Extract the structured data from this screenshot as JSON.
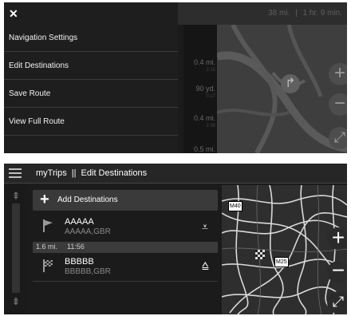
{
  "screen1": {
    "close_icon": "close-icon",
    "eta": {
      "distance": "38 mi.",
      "divider": "|",
      "time": "1 hr. 9 min."
    },
    "menu": [
      {
        "label": "Navigation Settings"
      },
      {
        "label": "Edit Destinations"
      },
      {
        "label": "Save Route"
      },
      {
        "label": "View Full Route"
      }
    ],
    "distances": [
      {
        "value": "0.4 mi.",
        "sub": "2:15"
      },
      {
        "value": "90 yd.",
        "sub": "0:17"
      },
      {
        "value": "0.4 mi.",
        "sub": "2:38"
      },
      {
        "value": "0.5 mi.",
        "sub": ""
      }
    ],
    "map_buttons": {
      "zoom_in": "+",
      "zoom_out": "−",
      "fullscreen": "⤢"
    }
  },
  "screen2": {
    "header": {
      "app": "myTrips",
      "divider": "||",
      "title": "Edit Destinations"
    },
    "add_label": "Add Destinations",
    "destinations": [
      {
        "name": "AAAAA",
        "subtitle": "AAAAA,GBR",
        "flag": "flag-icon",
        "action": "move-down-icon"
      },
      {
        "name": "BBBBB",
        "subtitle": "BBBBB,GBR",
        "flag": "checkered-flag-icon",
        "action": "move-up-icon"
      }
    ],
    "leg": {
      "distance": "1.6 mi.",
      "time": "11:56"
    },
    "road_signs": [
      "M40",
      "M25"
    ],
    "map_buttons": {
      "zoom_in": "+",
      "zoom_out": "−",
      "fullscreen": "⤢"
    }
  }
}
